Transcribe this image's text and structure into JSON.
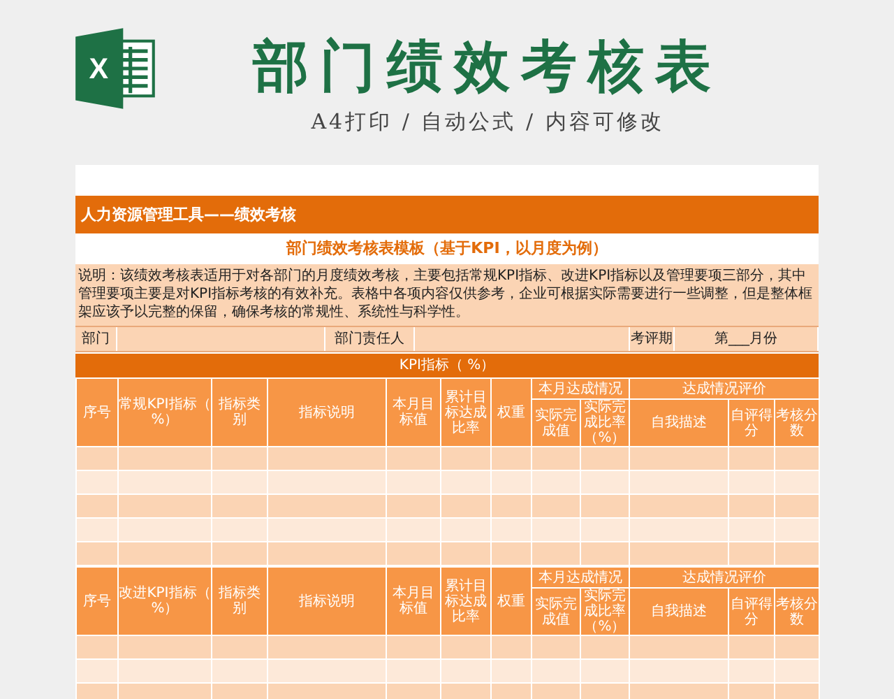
{
  "header": {
    "logo_letter": "X",
    "title": "部门绩效考核表",
    "tagline": "A4打印 / 自动公式 / 内容可修改"
  },
  "sheet": {
    "banner": "人力资源管理工具——绩效考核",
    "subtitle": "部门绩效考核表模板（基于KPI，以月度为例）",
    "description": "说明：该绩效考核表适用于对各部门的月度绩效考核，主要包括常规KPI指标、改进KPI指标以及管理要项三部分，其中管理要项主要是对KPI指标考核的有效补充。表格中各项内容仅供参考，企业可根据实际需要进行一些调整，但是整体框架应该予以完整的保留，确保考核的常规性、系统性与科学性。",
    "info": [
      {
        "label": "部门"
      },
      {
        "label": "部门责任人"
      },
      {
        "label": "考评期",
        "value": "第___月份"
      }
    ],
    "sections": [
      {
        "title": "KPI指标（   %）",
        "columns": [
          {
            "label": "序号"
          },
          {
            "label": "常规KPI指标（ %）"
          },
          {
            "label": "指标类别"
          },
          {
            "label": "指标说明"
          },
          {
            "label": "本月目标值"
          },
          {
            "label": "累计目标达成比率"
          },
          {
            "label": "权重"
          },
          {
            "label": "本月达成情况",
            "children": [
              {
                "label": "实际完成值"
              },
              {
                "label": "实际完成比率（%）"
              }
            ]
          },
          {
            "label": "达成情况评价",
            "children": [
              {
                "label": "自我描述"
              },
              {
                "label": "自评得分"
              },
              {
                "label": "考核分数"
              }
            ]
          }
        ],
        "rows": [
          {
            "kind": "empty"
          },
          {
            "kind": "empty"
          },
          {
            "kind": "empty"
          },
          {
            "kind": "empty"
          },
          {
            "kind": "empty"
          }
        ]
      },
      {
        "columns": [
          {
            "label": "序号"
          },
          {
            "label": "改进KPI指标（  %）"
          },
          {
            "label": "指标类别"
          },
          {
            "label": "指标说明"
          },
          {
            "label": "本月目标值"
          },
          {
            "label": "累计目标达成比率"
          },
          {
            "label": "权重"
          },
          {
            "label": "本月达成情况",
            "children": [
              {
                "label": "实际完成值"
              },
              {
                "label": "实际完成比率（%）"
              }
            ]
          },
          {
            "label": "达成情况评价",
            "children": [
              {
                "label": "自我描述"
              },
              {
                "label": "自评得分"
              },
              {
                "label": "考核分数"
              }
            ]
          }
        ],
        "rows": [
          {
            "kind": "empty"
          },
          {
            "kind": "empty"
          },
          {
            "kind": "empty"
          }
        ]
      }
    ]
  }
}
